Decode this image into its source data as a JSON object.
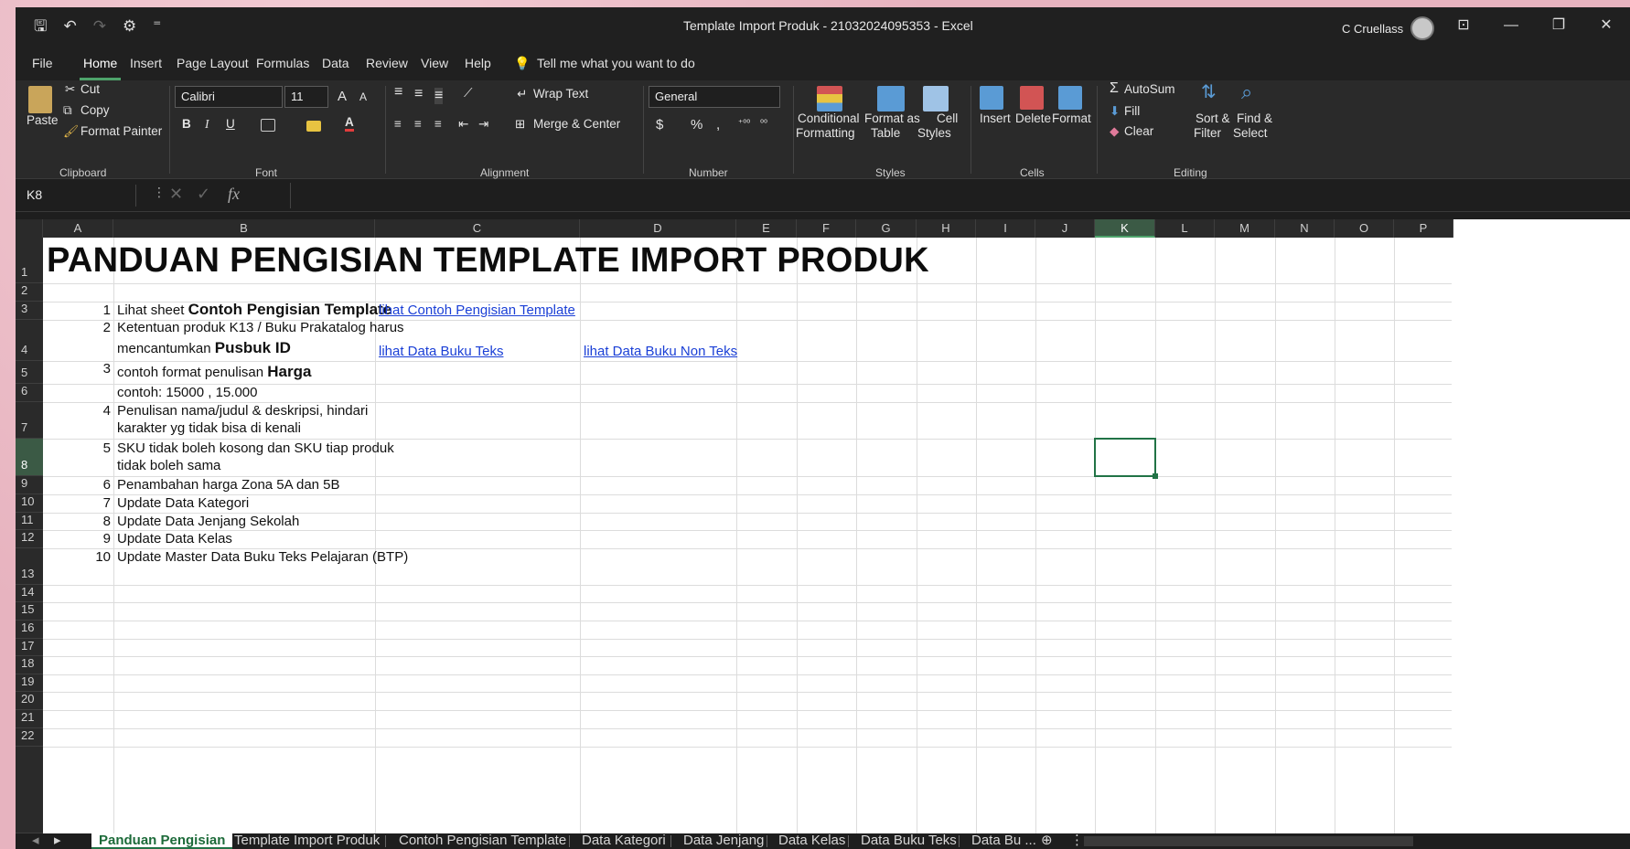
{
  "window": {
    "title": "Template Import Produk - 21032024095353  -  Excel",
    "user": "C Cruellass",
    "buttons": {
      "ribbon": "⊡",
      "minimize": "—",
      "restore": "❐",
      "close": "✕"
    }
  },
  "qat": {
    "save": "🖫",
    "undo": "↶",
    "redo": "↷",
    "custom": "⚙",
    "more": "⁼"
  },
  "menu": {
    "items": [
      "File",
      "Home",
      "Insert",
      "Page Layout",
      "Formulas",
      "Data",
      "Review",
      "View",
      "Help"
    ],
    "active": "Home",
    "tell_me": "Tell me what you want to do"
  },
  "ribbon": {
    "clipboard": {
      "paste": "Paste",
      "cut": "Cut",
      "copy": "Copy",
      "format_painter": "Format Painter",
      "group": "Clipboard"
    },
    "font": {
      "family": "Calibri",
      "size": "11",
      "bold": "B",
      "italic": "I",
      "underline": "U",
      "grow": "A",
      "shrink": "A",
      "font_color": "A",
      "group": "Font"
    },
    "alignment": {
      "wrap_text": "Wrap Text",
      "merge_center": "Merge & Center",
      "group": "Alignment"
    },
    "number": {
      "format": "General",
      "currency": "$",
      "percent": "%",
      "comma": ",",
      "group": "Number"
    },
    "styles": {
      "conditional": "Conditional",
      "conditional2": "Formatting",
      "format_table": "Format as",
      "format_table2": "Table",
      "cell_styles": "Cell",
      "cell_styles2": "Styles",
      "group": "Styles"
    },
    "cells": {
      "insert": "Insert",
      "delete": "Delete",
      "format": "Format",
      "group": "Cells"
    },
    "editing": {
      "autosum": "AutoSum",
      "fill": "Fill",
      "clear": "Clear",
      "sort_filter": "Sort &",
      "sort_filter2": "Filter",
      "find_select": "Find &",
      "find_select2": "Select",
      "group": "Editing"
    }
  },
  "formula_bar": {
    "name_box": "K8",
    "fx": "fx",
    "value": ""
  },
  "columns": [
    "A",
    "B",
    "C",
    "D",
    "E",
    "F",
    "G",
    "H",
    "I",
    "J",
    "K",
    "L",
    "M",
    "N",
    "O",
    "P"
  ],
  "selected_column": "K",
  "rows": [
    "1",
    "2",
    "3",
    "4",
    "5",
    "6",
    "7",
    "8",
    "9",
    "10",
    "11",
    "12",
    "13",
    "14",
    "15",
    "16",
    "17",
    "18",
    "19",
    "20",
    "21",
    "22"
  ],
  "selected_row": "8",
  "sheet": {
    "title": "PANDUAN PENGISIAN TEMPLATE IMPORT PRODUK",
    "items": [
      {
        "num": "1",
        "text": "Lihat sheet ",
        "bold": "Contoh Pengisian Template"
      },
      {
        "num": "2",
        "text": "Ketentuan produk K13 / Buku Prakatalog harus",
        "text2": "mencantumkan ",
        "bold": "Pusbuk ID"
      },
      {
        "num": "3",
        "text": "contoh format penulisan ",
        "bold": "Harga"
      },
      {
        "num": "",
        "text": "contoh: 15000 , 15.000"
      },
      {
        "num": "4",
        "text": "Penulisan nama/judul & deskripsi, hindari",
        "text2": "karakter yg tidak bisa di kenali"
      },
      {
        "num": "5",
        "text": "SKU tidak boleh kosong dan SKU tiap produk",
        "text2": "tidak boleh sama"
      },
      {
        "num": "6",
        "text": "Penambahan harga Zona 5A dan 5B"
      },
      {
        "num": "7",
        "text": "Update Data Kategori"
      },
      {
        "num": "8",
        "text": "Update Data Jenjang Sekolah"
      },
      {
        "num": "9",
        "text": "Update Data Kelas"
      },
      {
        "num": "10",
        "text": "Update Master Data Buku Teks Pelajaran (BTP)"
      }
    ],
    "links": {
      "contoh": "lihat Contoh Pengisian Template",
      "buku_teks": "lihat Data Buku Teks",
      "buku_non_teks": "lihat Data Buku Non Teks"
    }
  },
  "tabs": [
    "Panduan Pengisian",
    "Template Import Produk",
    "Contoh Pengisian Template",
    "Data Kategori",
    "Data Jenjang",
    "Data Kelas",
    "Data Buku Teks",
    "Data Bu ..."
  ],
  "active_tab": "Panduan Pengisian",
  "colors": {
    "accent": "#217346",
    "link": "#1a3fd6",
    "dark_bg": "#1e1e1e"
  }
}
